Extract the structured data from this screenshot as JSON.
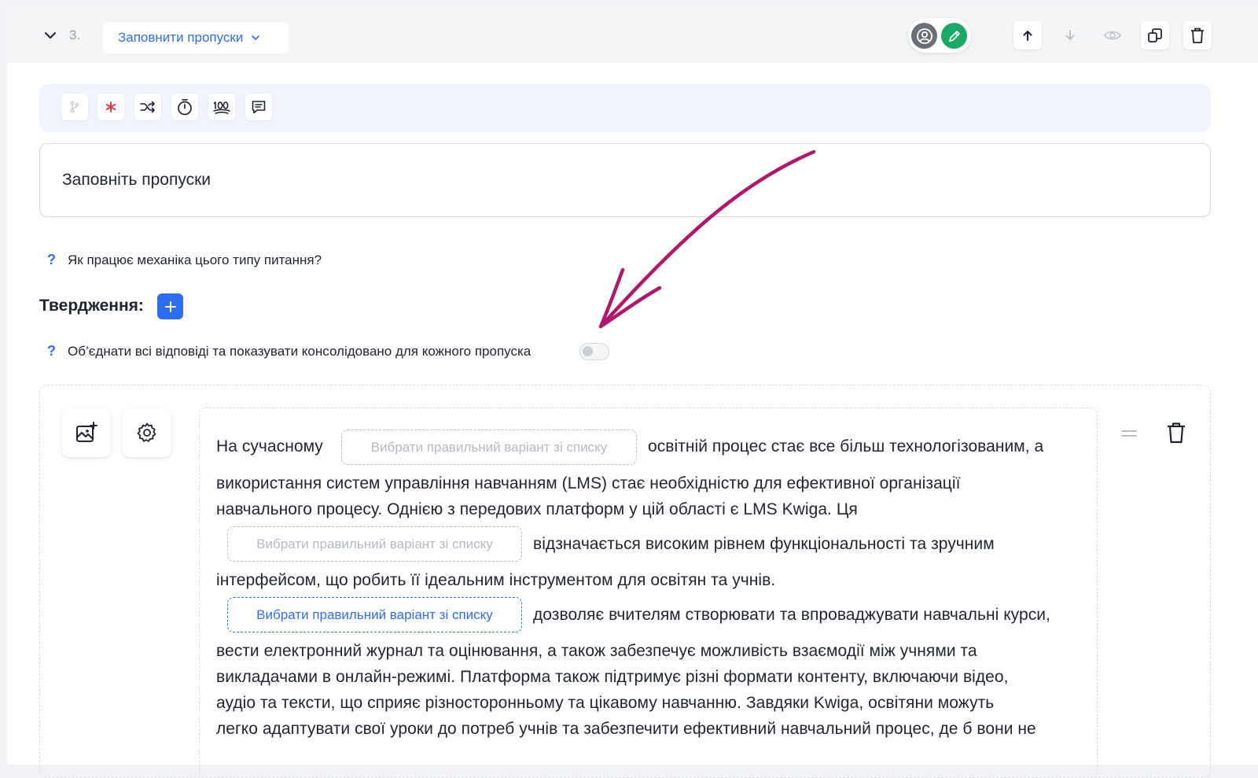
{
  "header": {
    "question_number": "3.",
    "question_type": "Заповнити пропуски"
  },
  "title_field": {
    "value": "Заповніть пропуски"
  },
  "help_mechanics": "Як працює механіка цього типу питання?",
  "statements_label": "Твердження:",
  "merge_option": {
    "label": "Об’єднати всі відповіді та показувати консолідовано для кожного пропуска",
    "enabled": false
  },
  "editor": {
    "line1_a": "На сучасному",
    "line1_b": "освітній процес стає все більш технологізованим, а",
    "line2": "використання систем управління навчанням (LMS) стає необхідністю для ефективної організації",
    "line3": "навчального процесу. Однією з передових платформ у цій області є LMS Kwiga. Ця",
    "line4_b": "відзначається високим рівнем функціональності та зручним",
    "line5": "інтерфейсом, що робить її ідеальним інструментом для освітян та учнів.",
    "line6_b": "дозволяє вчителям створювати та впроваджувати навчальні курси,",
    "line7": "вести електронний журнал та оцінювання, а також забезпечує можливість взаємодії між учнями та",
    "line8": "викладачами в онлайн-режимі. Платформа також підтримує різні формати контенту, включаючи відео,",
    "line9": "аудіо та тексти, що сприяє різносторонньому та цікавому навчанню. Завдяки Kwiga, освітяни можуть",
    "line10": "легко адаптувати свої уроки до потреб учнів та забезпечити ефективний навчальний процес, де б вони не",
    "blank_placeholder": "Вибрати правильний варіант зі списку"
  },
  "colors": {
    "accent": "#2f6df0",
    "edit_green": "#19a865",
    "required_red": "#e5383b",
    "annotation_arrow": "#b0166b"
  }
}
